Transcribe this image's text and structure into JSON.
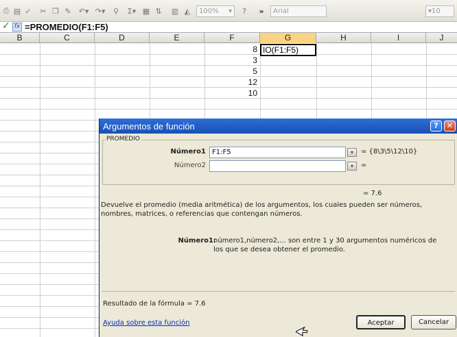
{
  "toolbar": {
    "zoom": "100%",
    "font_name": "Arial",
    "font_size": "10",
    "chevron": "»",
    "icons": [
      "print-preview-icon",
      "spelling-icon",
      "cut-icon",
      "copy-icon",
      "format-painter-icon",
      "undo-icon",
      "redo-icon",
      "hyperlink-icon",
      "autosum-icon",
      "chart-wizard-icon",
      "sort-ascending-icon",
      "drawing-icon",
      "help-icon"
    ]
  },
  "formula_bar": {
    "check": "✓",
    "fx": "fx",
    "formula": "=PROMEDIO(F1:F5)"
  },
  "sheet": {
    "columns": [
      "B",
      "C",
      "D",
      "E",
      "F",
      "G",
      "H",
      "I",
      "J"
    ],
    "selected_column": "G",
    "values_f": [
      "8",
      "3",
      "5",
      "12",
      "10"
    ],
    "active_cell_text": "IO(F1:F5)"
  },
  "dialog": {
    "title": "Argumentos de función",
    "help_glyph": "?",
    "close_glyph": "✕",
    "function_name": "PROMEDIO",
    "arg1_label": "Número1",
    "arg1_value": "F1:F5",
    "arg1_result": "=  {8\\3\\5\\12\\10}",
    "arg2_label": "Número2",
    "arg2_value": "",
    "arg2_result": "=",
    "result_preview": "=  7.6",
    "description": "Devuelve el promedio (media aritmética) de los argumentos, los cuales pueden ser números, nombres, matrices, o referencias que contengan números.",
    "param_name": "Número1:",
    "param_desc": "número1,número2,... son entre 1 y 30 argumentos numéricos de los que se desea obtener el promedio.",
    "formula_result": "Resultado de la fórmula =  7.6",
    "help_link": "Ayuda sobre esta función",
    "ok_label": "Aceptar",
    "cancel_label": "Cancelar"
  }
}
